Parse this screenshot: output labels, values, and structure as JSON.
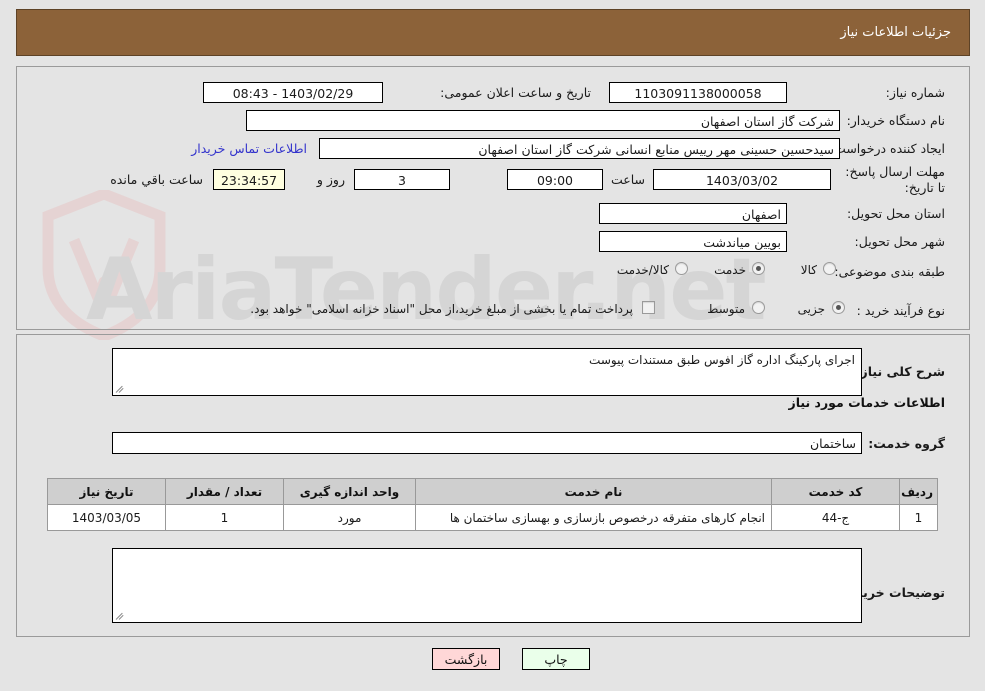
{
  "header": {
    "title": "جزئیات اطلاعات نیاز"
  },
  "watermark": {
    "text": "AriaTender.net"
  },
  "form": {
    "need_number_label": "شماره نیاز:",
    "need_number_value": "1103091138000058",
    "announce_datetime_label": "تاریخ و ساعت اعلان عمومی:",
    "announce_datetime_value": "1403/02/29 - 08:43",
    "buyer_org_label": "نام دستگاه خریدار:",
    "buyer_org_value": "شرکت گاز استان اصفهان",
    "creator_label": "ایجاد کننده درخواست:",
    "creator_value": "سیدحسین حسینی مهر رییس منابع انسانی شرکت گاز استان اصفهان",
    "contact_link": "اطلاعات تماس خریدار",
    "deadline_label": "مهلت ارسال پاسخ: تا تاریخ:",
    "deadline_date": "1403/03/02",
    "hour_label": "ساعت",
    "deadline_time": "09:00",
    "days_value": "3",
    "days_label": "روز و",
    "countdown_value": "23:34:57",
    "countdown_label": "ساعت باقي مانده",
    "province_label": "استان محل تحویل:",
    "province_value": "اصفهان",
    "city_label": "شهر محل تحویل:",
    "city_value": "بویین میاندشت",
    "category_label": "طبقه بندی موضوعی:",
    "category_options": [
      {
        "label": "کالا",
        "selected": false
      },
      {
        "label": "خدمت",
        "selected": true
      },
      {
        "label": "کالا/خدمت",
        "selected": false
      }
    ],
    "process_label": "نوع فرآیند خرید :",
    "process_options": [
      {
        "label": "جزیی",
        "selected": true
      },
      {
        "label": "متوسط",
        "selected": false
      }
    ],
    "treasury_note": "پرداخت تمام یا بخشی از مبلغ خرید،از محل \"اسناد خزانه اسلامی\" خواهد بود.",
    "treasury_checked": false
  },
  "body": {
    "general_desc_label": "شرح کلی نیاز:",
    "general_desc_value": "اجرای پارکینگ اداره گاز افوس طبق مستندات پیوست",
    "services_section_title": "اطلاعات خدمات مورد نیاز",
    "service_group_label": "گروه خدمت:",
    "service_group_value": "ساختمان",
    "buyer_notes_label": "توضیحات خریدار:",
    "buyer_notes_value": ""
  },
  "table": {
    "columns": [
      "ردیف",
      "کد خدمت",
      "نام خدمت",
      "واحد اندازه گیری",
      "تعداد / مقدار",
      "تاریخ نیاز"
    ],
    "rows": [
      {
        "row": "1",
        "code": "ج-44",
        "name": "انجام کارهای متفرقه درخصوص بازسازی و بهسازی ساختمان ها",
        "unit": "مورد",
        "qty": "1",
        "date": "1403/03/05"
      }
    ]
  },
  "footer": {
    "print_label": "چاپ",
    "back_label": "بازگشت"
  },
  "colors": {
    "header_bg": "#8c6239",
    "page_bg": "#e4e4e4",
    "link": "#3333cc",
    "timer_bg": "#ffffe0",
    "print_bg": "#eaffea",
    "back_bg": "#ffd7d7"
  }
}
